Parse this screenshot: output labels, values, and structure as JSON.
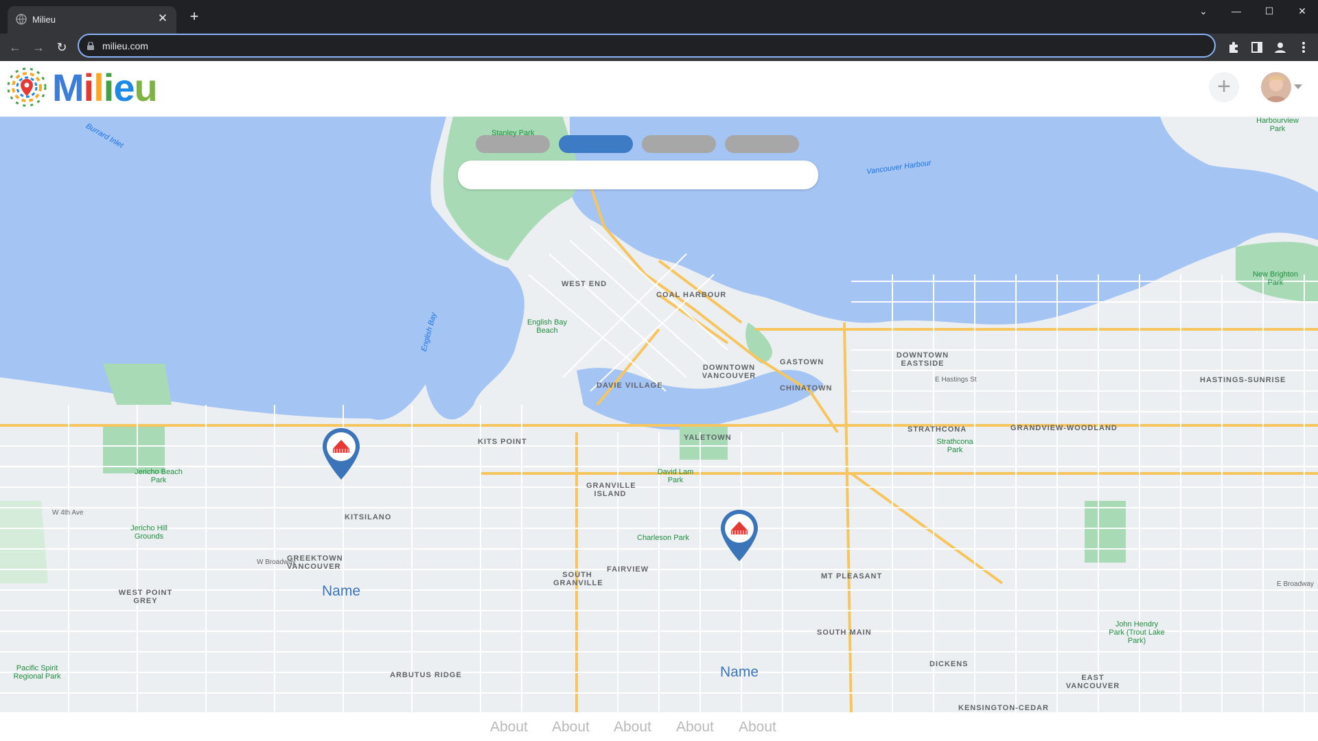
{
  "browser": {
    "tab_title": "Milieu",
    "url": "milieu.com",
    "tab_close": "✕",
    "new_tab": "+"
  },
  "header": {
    "logo_text": "Milieu",
    "add_label": "+"
  },
  "map": {
    "segments": [
      "",
      "",
      "",
      ""
    ],
    "active_segment": 1,
    "search_placeholder": "",
    "labels": {
      "burrard_inlet": "Burrard Inlet",
      "stanley_park": "Stanley Park",
      "harbourview_park": "Harbourview Park",
      "vancouver_harbour": "Vancouver Harbour",
      "west_end": "WEST END",
      "coal_harbour": "COAL HARBOUR",
      "english_bay_beach": "English Bay Beach",
      "english_bay": "English Bay",
      "davie_village": "DAVIE VILLAGE",
      "downtown_vancouver": "DOWNTOWN VANCOUVER",
      "gastown": "GASTOWN",
      "chinatown": "CHINATOWN",
      "downtown_eastside": "DOWNTOWN EASTSIDE",
      "new_brighton_park": "New Brighton Park",
      "hastings_sunrise": "HASTINGS-SUNRISE",
      "strathcona": "STRATHCONA",
      "strathcona_park": "Strathcona Park",
      "grandview_woodland": "GRANDVIEW-WOODLAND",
      "yaletown": "YALETOWN",
      "kits_point": "KITS POINT",
      "kitsilano": "KITSILANO",
      "granville_island": "GRANVILLE ISLAND",
      "david_lam_park": "David Lam Park",
      "charleson_park": "Charleson Park",
      "jericho_beach_park": "Jericho Beach Park",
      "jericho_hill_grounds": "Jericho Hill Grounds",
      "greektown": "GREEKTOWN VANCOUVER",
      "west_point_grey": "WEST POINT GREY",
      "fairview": "FAIRVIEW",
      "south_granville": "SOUTH GRANVILLE",
      "mt_pleasant": "MT PLEASANT",
      "south_main": "SOUTH MAIN",
      "dickens": "DICKENS",
      "arbutus_ridge": "ARBUTUS RIDGE",
      "pacific_spirit": "Pacific Spirit Regional Park",
      "john_hendry": "John Hendry Park (Trout Lake Park)",
      "east_vancouver": "EAST VANCOUVER",
      "kensington_cedar": "KENSINGTON-CEDAR",
      "e_hastings": "E Hastings St",
      "e_broadway": "E Broadway",
      "w_4th": "W 4th Ave",
      "w_broadway": "W Broadway"
    },
    "pins": [
      {
        "name": "Name"
      },
      {
        "name": "Name"
      }
    ]
  },
  "footer": {
    "links": [
      "About",
      "About",
      "About",
      "About",
      "About"
    ]
  },
  "colors": {
    "water": "#a4c4f4",
    "park": "#a8dab5",
    "land": "#eceff1",
    "road_major": "#f7c55e",
    "accent": "#3d7cc5"
  }
}
